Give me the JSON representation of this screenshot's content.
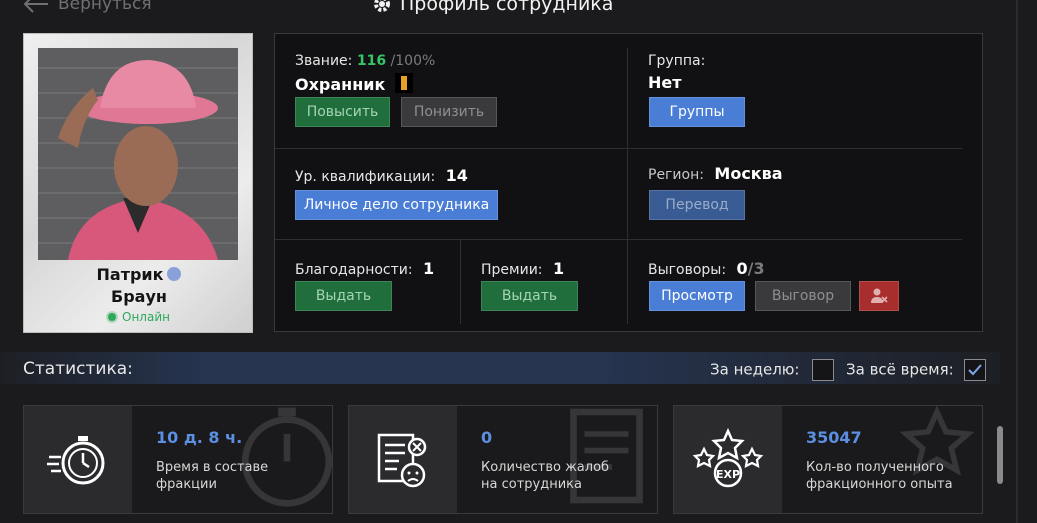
{
  "header": {
    "back_label": "Вернуться",
    "title": "Профиль сотрудника"
  },
  "profile": {
    "first_name": "Патрик",
    "last_name": "Браун",
    "status": "Онлайн"
  },
  "rank": {
    "label": "Звание:",
    "value": "116",
    "max": "/100%",
    "name": "Охранник",
    "promote_label": "Повысить",
    "demote_label": "Понизить"
  },
  "group": {
    "label": "Группа:",
    "value": "Нет",
    "groups_button": "Группы"
  },
  "qualification": {
    "label": "Ур. квалификации:",
    "value": "14",
    "file_button": "Личное дело сотрудника"
  },
  "region": {
    "label": "Регион:",
    "value": "Москва",
    "transfer_button": "Перевод"
  },
  "thanks": {
    "label": "Благодарности:",
    "value": "1",
    "give_button": "Выдать"
  },
  "bonuses": {
    "label": "Премии:",
    "value": "1",
    "give_button": "Выдать"
  },
  "reprimands": {
    "label": "Выговоры:",
    "value": "0",
    "max": "/3",
    "view_button": "Просмотр",
    "reprimand_button": "Выговор"
  },
  "stats": {
    "title": "Статистика:",
    "week_label": "За неделю:",
    "alltime_label": "За всё время:",
    "week_checked": false,
    "alltime_checked": true,
    "cards": [
      {
        "value": "10 д. 8 ч.",
        "line1": "Время в составе",
        "line2": "фракции"
      },
      {
        "value": "0",
        "line1": "Количество жалоб",
        "line2": "на сотрудника"
      },
      {
        "value": "35047",
        "line1": "Кол-во полученного",
        "line2": "фракционного опыта"
      }
    ]
  },
  "colors": {
    "accent_blue": "#4a7ed6",
    "green": "#35c466",
    "danger": "#a82d2d"
  }
}
